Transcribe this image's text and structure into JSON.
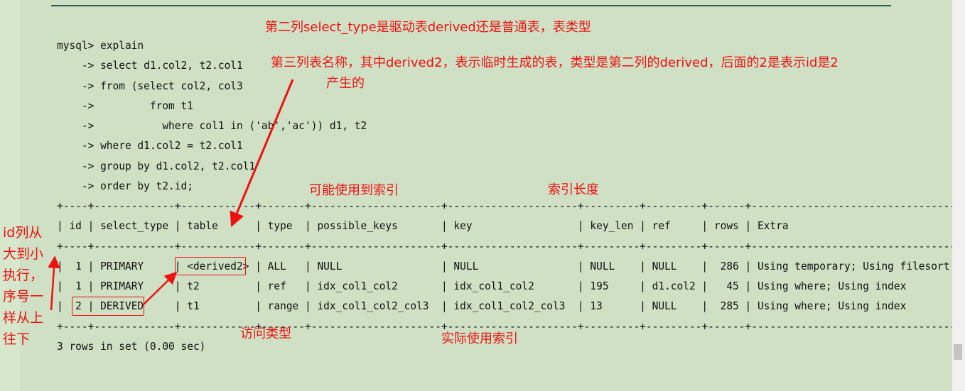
{
  "sql_lines": [
    "mysql> explain",
    "    -> select d1.col2, t2.col1",
    "    -> from (select col2, col3",
    "    ->         from t1",
    "    ->           where col1 in ('ab','ac')) d1, t2",
    "    -> where d1.col2 = t2.col1",
    "    -> group by d1.col2, t2.col1",
    "    -> order by t2.id;"
  ],
  "result": {
    "border": "+----+-------------+------------+-------+---------------------+---------------------+---------+---------+------+---------------------------------+",
    "header": "| id | select_type | table      | type  | possible_keys       | key                 | key_len | ref     | rows | Extra                           |",
    "rows": [
      "|  1 | PRIMARY     | <derived2> | ALL   | NULL                | NULL                | NULL    | NULL    |  286 | Using temporary; Using filesort |",
      "|  1 | PRIMARY     | t2         | ref   | idx_col1_col2       | idx_col1_col2       | 195     | d1.col2 |   45 | Using where; Using index        |",
      "|  2 | DERIVED     | t1         | range | idx_col1_col2_col3  | idx_col1_col2_col3  | 13      | NULL    |  285 | Using where; Using index        |"
    ],
    "footer": "3 rows in set (0.00 sec)"
  },
  "annotations": {
    "select_type_note": "第二列select_type是驱动表derived还是普通表，表类型",
    "table_note_line1": "第三列表名称，其中derived2，表示临时生成的表，类型是第二列的derived，后面的2是表示id是2",
    "table_note_line2": "产生的",
    "possible_keys_note": "可能使用到索引",
    "key_len_note": "索引长度",
    "type_note": "访问类型",
    "key_note": "实际使用索引",
    "id_note": "id列从大到小执行，序号一样从上往下"
  },
  "colors": {
    "background": "#cfe0c4",
    "annotation": "#ee1111",
    "terminal_text": "#111111"
  }
}
